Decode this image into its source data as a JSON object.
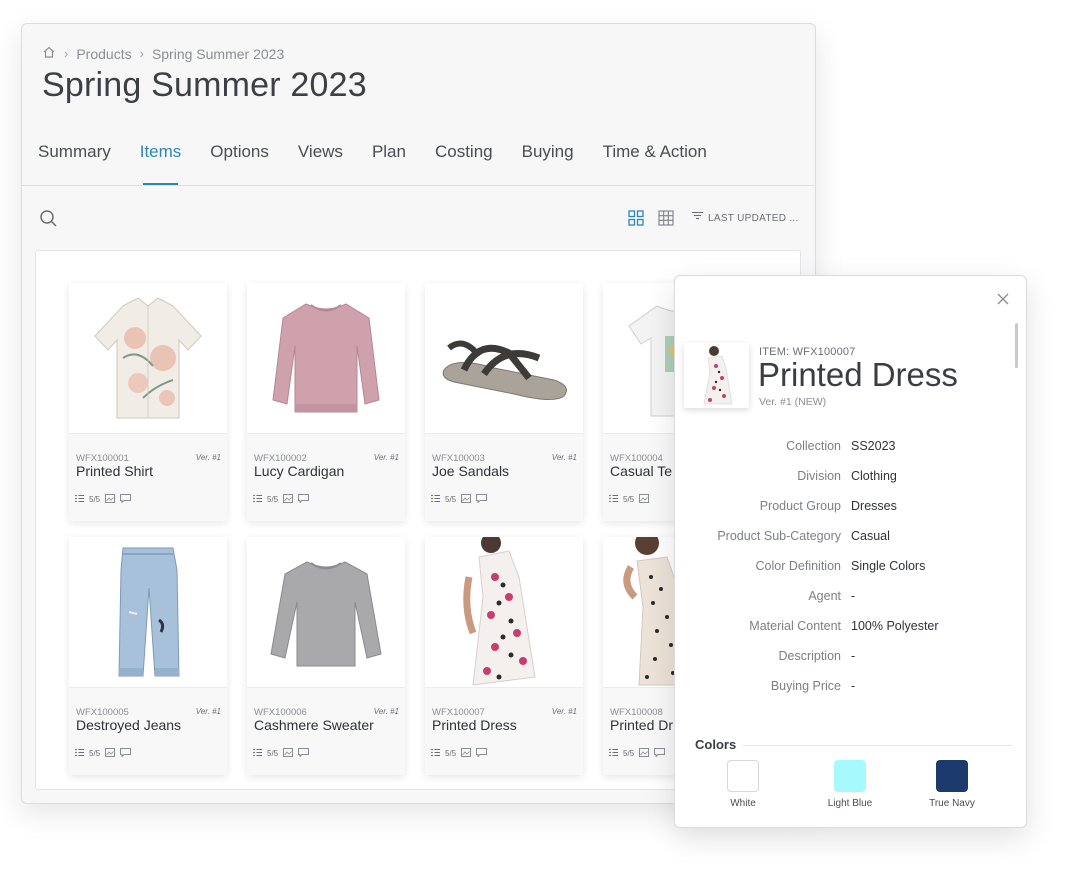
{
  "breadcrumb": {
    "home_icon": "home-icon",
    "items": [
      "Products",
      "Spring Summer 2023"
    ]
  },
  "page_title": "Spring Summer 2023",
  "tabs": [
    {
      "label": "Summary",
      "active": false
    },
    {
      "label": "Items",
      "active": true
    },
    {
      "label": "Options",
      "active": false
    },
    {
      "label": "Views",
      "active": false
    },
    {
      "label": "Plan",
      "active": false
    },
    {
      "label": "Costing",
      "active": false
    },
    {
      "label": "Buying",
      "active": false
    },
    {
      "label": "Time & Action",
      "active": false
    }
  ],
  "toolbar": {
    "sort_label": "LAST UPDATED ...",
    "accent": "#2e86b8"
  },
  "cards": [
    {
      "code": "WFX100001",
      "ver": "Ver. #1",
      "name": "Printed Shirt",
      "meta": "5/5",
      "icon": "shirt-image"
    },
    {
      "code": "WFX100002",
      "ver": "Ver. #1",
      "name": "Lucy Cardigan",
      "meta": "5/5",
      "icon": "sweatshirt-image"
    },
    {
      "code": "WFX100003",
      "ver": "Ver. #1",
      "name": "Joe Sandals",
      "meta": "5/5",
      "icon": "sandal-image"
    },
    {
      "code": "WFX100004",
      "ver": "",
      "name": "Casual Te",
      "meta": "5/5",
      "icon": "tshirt-image"
    },
    {
      "code": "WFX100005",
      "ver": "Ver. #1",
      "name": "Destroyed Jeans",
      "meta": "5/5",
      "icon": "jeans-image"
    },
    {
      "code": "WFX100006",
      "ver": "Ver. #1",
      "name": "Cashmere Sweater",
      "meta": "5/5",
      "icon": "sweater-image"
    },
    {
      "code": "WFX100007",
      "ver": "Ver. #1",
      "name": "Printed Dress",
      "meta": "5/5",
      "icon": "dress-image"
    },
    {
      "code": "WFX100008",
      "ver": "",
      "name": "Printed Dr",
      "meta": "5/5",
      "icon": "dress-image"
    }
  ],
  "detail": {
    "item_label": "ITEM: WFX100007",
    "title": "Printed Dress",
    "version": "Ver. #1 (NEW)",
    "attributes": [
      {
        "key": "Collection",
        "value": "SS2023"
      },
      {
        "key": "Division",
        "value": "Clothing"
      },
      {
        "key": "Product Group",
        "value": "Dresses"
      },
      {
        "key": "Product Sub-Category",
        "value": "Casual"
      },
      {
        "key": "Color Definition",
        "value": "Single Colors"
      },
      {
        "key": "Agent",
        "value": "-"
      },
      {
        "key": "Material Content",
        "value": "100% Polyester"
      },
      {
        "key": "Description",
        "value": "-"
      },
      {
        "key": "Buying Price",
        "value": "-"
      }
    ],
    "colors_title": "Colors",
    "colors": [
      {
        "name": "White",
        "hex": "#ffffff"
      },
      {
        "name": "Light Blue",
        "hex": "#a6fafd"
      },
      {
        "name": "True Navy",
        "hex": "#1c3a6e"
      }
    ]
  }
}
